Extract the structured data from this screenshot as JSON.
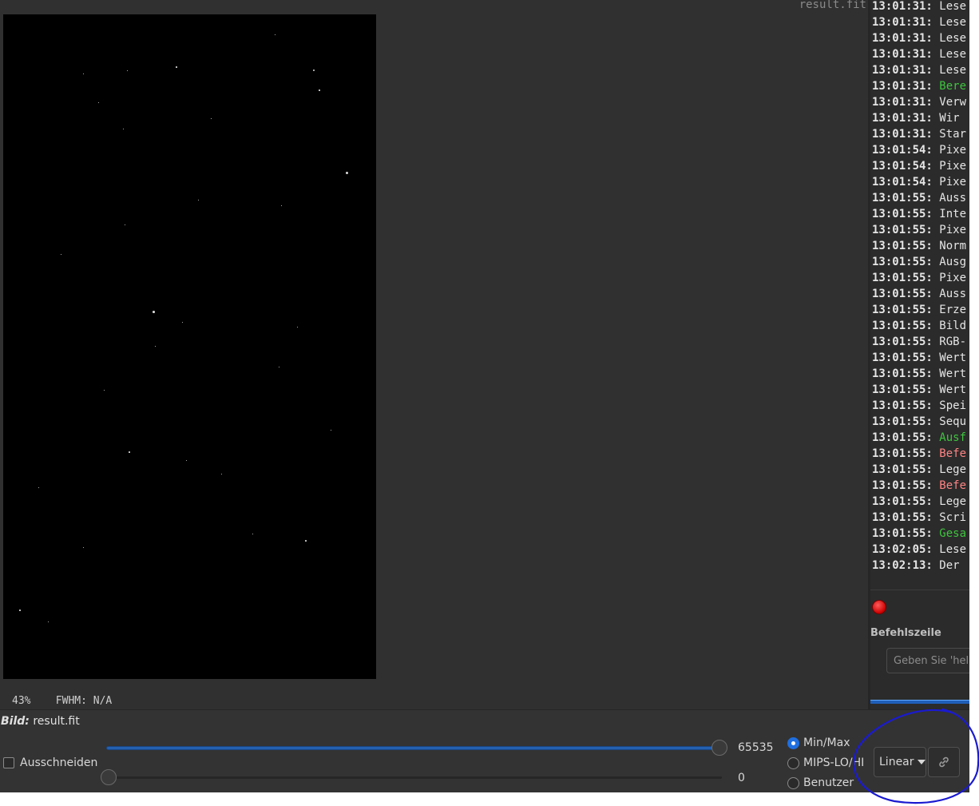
{
  "viewer": {
    "filename": "result.fit",
    "zoom": "43%",
    "fwhm": "FWHM: N/A"
  },
  "console": {
    "lines": [
      {
        "time": "13:01:31:",
        "msg": "Lese",
        "status": "normal"
      },
      {
        "time": "13:01:31:",
        "msg": "Lese",
        "status": "normal"
      },
      {
        "time": "13:01:31:",
        "msg": "Lese",
        "status": "normal"
      },
      {
        "time": "13:01:31:",
        "msg": "Lese",
        "status": "normal"
      },
      {
        "time": "13:01:31:",
        "msg": "Lese",
        "status": "normal"
      },
      {
        "time": "13:01:31:",
        "msg": "Bere",
        "status": "green"
      },
      {
        "time": "13:01:31:",
        "msg": "Verw",
        "status": "normal"
      },
      {
        "time": "13:01:31:",
        "msg": "Wir",
        "status": "normal"
      },
      {
        "time": "13:01:31:",
        "msg": "Star",
        "status": "normal"
      },
      {
        "time": "13:01:54:",
        "msg": "Pixe",
        "status": "normal"
      },
      {
        "time": "13:01:54:",
        "msg": "Pixe",
        "status": "normal"
      },
      {
        "time": "13:01:54:",
        "msg": "Pixe",
        "status": "normal"
      },
      {
        "time": "13:01:55:",
        "msg": "Auss",
        "status": "normal"
      },
      {
        "time": "13:01:55:",
        "msg": "Inte",
        "status": "normal"
      },
      {
        "time": "13:01:55:",
        "msg": "Pixe",
        "status": "normal"
      },
      {
        "time": "13:01:55:",
        "msg": "Norm",
        "status": "normal"
      },
      {
        "time": "13:01:55:",
        "msg": "Ausg",
        "status": "normal"
      },
      {
        "time": "13:01:55:",
        "msg": "Pixe",
        "status": "normal"
      },
      {
        "time": "13:01:55:",
        "msg": "Auss",
        "status": "normal"
      },
      {
        "time": "13:01:55:",
        "msg": "Erze",
        "status": "normal"
      },
      {
        "time": "13:01:55:",
        "msg": "Bild",
        "status": "normal"
      },
      {
        "time": "13:01:55:",
        "msg": "RGB-",
        "status": "normal"
      },
      {
        "time": "13:01:55:",
        "msg": "Wert",
        "status": "normal"
      },
      {
        "time": "13:01:55:",
        "msg": "Wert",
        "status": "normal"
      },
      {
        "time": "13:01:55:",
        "msg": "Wert",
        "status": "normal"
      },
      {
        "time": "13:01:55:",
        "msg": "Spei",
        "status": "normal"
      },
      {
        "time": "13:01:55:",
        "msg": "Sequ",
        "status": "normal"
      },
      {
        "time": "13:01:55:",
        "msg": "Ausf",
        "status": "green"
      },
      {
        "time": "13:01:55:",
        "msg": "Befe",
        "status": "red"
      },
      {
        "time": "13:01:55:",
        "msg": "Lege",
        "status": "normal"
      },
      {
        "time": "13:01:55:",
        "msg": "Befe",
        "status": "red"
      },
      {
        "time": "13:01:55:",
        "msg": "Lege",
        "status": "normal"
      },
      {
        "time": "13:01:55:",
        "msg": "Scri",
        "status": "normal"
      },
      {
        "time": "13:01:55:",
        "msg": "Gesa",
        "status": "green"
      },
      {
        "time": "13:02:05:",
        "msg": "Lese",
        "status": "normal"
      },
      {
        "time": "13:02:13:",
        "msg": "Der",
        "status": "normal"
      }
    ],
    "command_label": "Befehlszeile",
    "command_placeholder": "Geben Sie 'help'"
  },
  "bottom": {
    "image_label": "Bild:",
    "image_name": "result.fit",
    "crop_label": "Ausschneiden",
    "hi_value": "65535",
    "lo_value": "0",
    "modes": [
      {
        "label": "Min/Max",
        "selected": true
      },
      {
        "label": "MIPS-LO/HI",
        "selected": false
      },
      {
        "label": "Benutzer",
        "selected": false
      }
    ],
    "scale_mode": "Linear"
  },
  "colors": {
    "accent": "#1f6fe0",
    "log_green": "#3ec43e",
    "log_red": "#ff8383",
    "annotation": "#1a1ad0"
  },
  "icons": {
    "stop": "stop-icon",
    "link": "link-icon",
    "dropdown": "chevron-down-icon"
  }
}
